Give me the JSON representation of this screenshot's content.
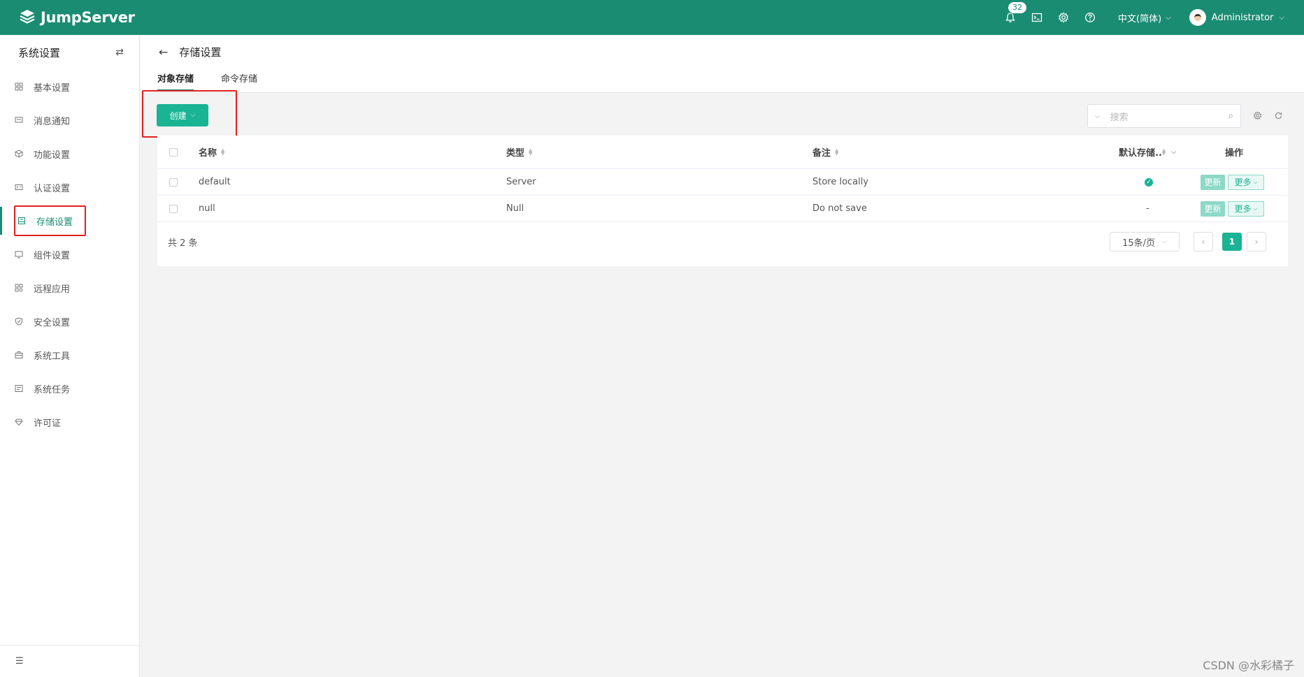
{
  "header": {
    "brand": "JumpServer",
    "notification_count": "32",
    "language": "中文(简体)",
    "user": "Administrator",
    "colors": {
      "primary": "#1a8c72",
      "accent": "#1ab394",
      "highlight": "#e0201f"
    }
  },
  "sidebar": {
    "title": "系统设置",
    "items": [
      {
        "label": "基本设置",
        "icon": "grid-icon"
      },
      {
        "label": "消息通知",
        "icon": "message-icon"
      },
      {
        "label": "功能设置",
        "icon": "cube-icon"
      },
      {
        "label": "认证设置",
        "icon": "id-card-icon"
      },
      {
        "label": "存储设置",
        "icon": "storage-icon",
        "active": true
      },
      {
        "label": "组件设置",
        "icon": "monitor-icon"
      },
      {
        "label": "远程应用",
        "icon": "apps-icon"
      },
      {
        "label": "安全设置",
        "icon": "shield-icon"
      },
      {
        "label": "系统工具",
        "icon": "briefcase-icon"
      },
      {
        "label": "系统任务",
        "icon": "task-icon"
      },
      {
        "label": "许可证",
        "icon": "diamond-icon"
      }
    ]
  },
  "page": {
    "title": "存储设置",
    "tabs": [
      {
        "label": "对象存储",
        "active": true
      },
      {
        "label": "命令存储",
        "active": false
      }
    ]
  },
  "toolbar": {
    "create_label": "创建",
    "search_placeholder": "搜索"
  },
  "table": {
    "columns": [
      "名称",
      "类型",
      "备注",
      "默认存储..",
      "操作"
    ],
    "rows": [
      {
        "name": "default",
        "type": "Server",
        "comment": "Store locally",
        "is_default": "✓",
        "update": "更新",
        "more": "更多"
      },
      {
        "name": "null",
        "type": "Null",
        "comment": "Do not save",
        "is_default": "-",
        "update": "更新",
        "more": "更多"
      }
    ],
    "total": "共 2 条",
    "page_size": "15条/页",
    "current_page": "1"
  },
  "watermark": "CSDN @水彩橘子"
}
